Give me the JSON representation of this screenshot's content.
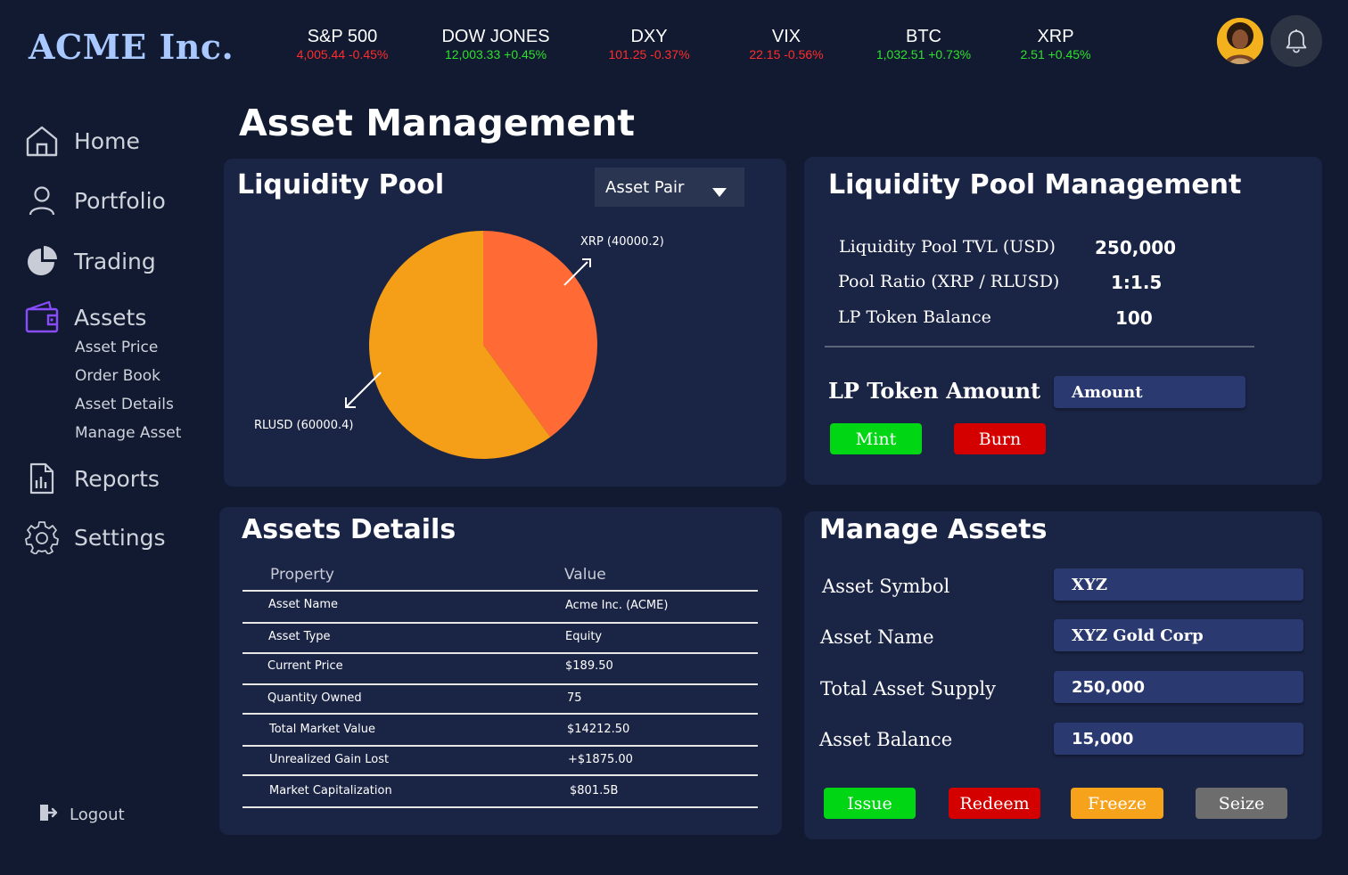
{
  "app": {
    "logo": "ACME Inc."
  },
  "tickers": [
    {
      "name": "S&P 500",
      "value": "4,005.44 -0.45%",
      "direction": "down"
    },
    {
      "name": "DOW JONES",
      "value": "12,003.33 +0.45%",
      "direction": "up"
    },
    {
      "name": "DXY",
      "value": "101.25 -0.37%",
      "direction": "down"
    },
    {
      "name": "VIX",
      "value": "22.15 -0.56%",
      "direction": "down"
    },
    {
      "name": "BTC",
      "value": "1,032.51 +0.73%",
      "direction": "up"
    },
    {
      "name": "XRP",
      "value": "2.51 +0.45%",
      "direction": "up"
    }
  ],
  "sidebar": {
    "items": [
      {
        "label": "Home",
        "icon": "home-icon"
      },
      {
        "label": "Portfolio",
        "icon": "user-icon"
      },
      {
        "label": "Trading",
        "icon": "pie-chart-icon"
      },
      {
        "label": "Assets",
        "icon": "wallet-icon"
      },
      {
        "label": "Reports",
        "icon": "report-icon"
      },
      {
        "label": "Settings",
        "icon": "gear-icon"
      }
    ],
    "asset_subitems": [
      "Asset Price",
      "Order Book",
      "Asset Details",
      "Manage Asset"
    ],
    "logout": "Logout"
  },
  "page": {
    "title": "Asset Management"
  },
  "liquidity_pool": {
    "title": "Liquidity Pool",
    "dropdown": "Asset Pair",
    "xrp_label": "XRP (40000.2)",
    "rlusd_label": "RLUSD (60000.4)"
  },
  "chart_data": {
    "type": "pie",
    "slices": [
      {
        "label": "XRP (40000.2)",
        "value": 40000.2,
        "color": "#ff6a35"
      },
      {
        "label": "RLUSD (60000.4)",
        "value": 60000.4,
        "color": "#f59e17"
      }
    ]
  },
  "lp_management": {
    "title": "Liquidity Pool Management",
    "rows": [
      {
        "label": "Liquidity Pool TVL (USD)",
        "value": "250,000"
      },
      {
        "label": "Pool Ratio (XRP / RLUSD)",
        "value": "1:1.5"
      },
      {
        "label": "LP Token Balance",
        "value": "100"
      }
    ],
    "token_amount_label": "LP Token Amount",
    "amount_placeholder": "Amount",
    "mint": "Mint",
    "burn": "Burn"
  },
  "assets_details": {
    "title": "Assets Details",
    "columns": [
      "Property",
      "Value"
    ],
    "rows": [
      [
        "Asset Name",
        "Acme Inc. (ACME)"
      ],
      [
        "Asset Type",
        "Equity"
      ],
      [
        "Current Price",
        "$189.50"
      ],
      [
        "Quantity Owned",
        "75"
      ],
      [
        "Total Market Value",
        "$14212.50"
      ],
      [
        "Unrealized Gain Lost",
        "+$1875.00"
      ],
      [
        "Market Capitalization",
        "$801.5B"
      ]
    ]
  },
  "manage_assets": {
    "title": "Manage Assets",
    "fields": [
      {
        "label": "Asset Symbol",
        "value": "XYZ"
      },
      {
        "label": "Asset Name",
        "value": "XYZ Gold Corp"
      },
      {
        "label": "Total Asset Supply",
        "value": "250,000"
      },
      {
        "label": "Asset Balance",
        "value": "15,000"
      }
    ],
    "buttons": {
      "issue": "Issue",
      "redeem": "Redeem",
      "freeze": "Freeze",
      "seize": "Seize"
    }
  },
  "colors": {
    "background": "#111a30",
    "card": "#1a2445",
    "logo": "#a8c8ff",
    "positive": "#2ee02e",
    "negative": "#ff2d2d",
    "mint": "#00d614",
    "burn": "#d40000",
    "freeze": "#f7a21b",
    "seize": "#6d6d6d"
  }
}
